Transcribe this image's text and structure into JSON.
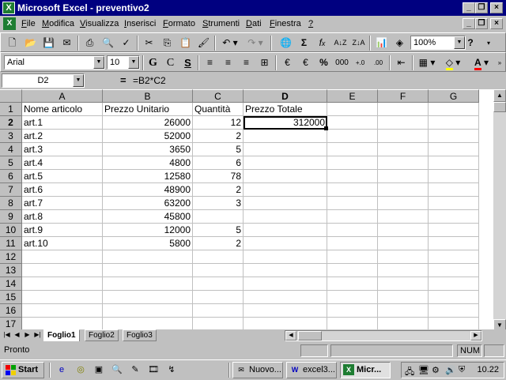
{
  "window": {
    "title": "Microsoft Excel - preventivo2",
    "app_icon": "excel-icon"
  },
  "menu": {
    "items": [
      {
        "label": "File",
        "accel": "F",
        "rest": "ile"
      },
      {
        "label": "Modifica",
        "accel": "M",
        "rest": "odifica"
      },
      {
        "label": "Visualizza",
        "accel": "V",
        "rest": "isualizza"
      },
      {
        "label": "Inserisci",
        "accel": "I",
        "rest": "nserisci"
      },
      {
        "label": "Formato",
        "accel": "F",
        "rest": "ormato"
      },
      {
        "label": "Strumenti",
        "accel": "S",
        "rest": "trumenti"
      },
      {
        "label": "Dati",
        "accel": "D",
        "rest": "ati"
      },
      {
        "label": "Finestra",
        "accel": "F",
        "rest": "inestra"
      },
      {
        "label": "?",
        "accel": "?",
        "rest": ""
      }
    ]
  },
  "standard_toolbar": {
    "zoom": "100%"
  },
  "format_toolbar": {
    "font": "Arial",
    "size": "10",
    "bold": "G",
    "italic": "C",
    "underline": "S",
    "currency": "€",
    "percent": "%",
    "thousands": "000"
  },
  "formula_bar": {
    "name_box": "D2",
    "equals": "=",
    "formula": "=B2*C2"
  },
  "sheet": {
    "columns": [
      "A",
      "B",
      "C",
      "D",
      "E",
      "F",
      "G"
    ],
    "selected_column": "D",
    "selected_row": "2",
    "rows": [
      "1",
      "2",
      "3",
      "4",
      "5",
      "6",
      "7",
      "8",
      "9",
      "10",
      "11",
      "12",
      "13",
      "14",
      "15",
      "16",
      "17"
    ],
    "header_row": [
      "Nome articolo",
      "Prezzo Unitario",
      "Quantità",
      "Prezzo Totale"
    ],
    "data": [
      [
        "art.1",
        "26000",
        "12",
        "312000"
      ],
      [
        "art.2",
        "52000",
        "2",
        ""
      ],
      [
        "art.3",
        "3650",
        "5",
        ""
      ],
      [
        "art.4",
        "4800",
        "6",
        ""
      ],
      [
        "art.5",
        "12580",
        "78",
        ""
      ],
      [
        "art.6",
        "48900",
        "2",
        ""
      ],
      [
        "art.7",
        "63200",
        "3",
        ""
      ],
      [
        "art.8",
        "45800",
        "",
        ""
      ],
      [
        "art.9",
        "12000",
        "5",
        ""
      ],
      [
        "art.10",
        "5800",
        "2",
        ""
      ]
    ]
  },
  "tabs": [
    "Foglio1",
    "Foglio2",
    "Foglio3"
  ],
  "active_tab": "Foglio1",
  "status": {
    "text": "Pronto",
    "num": "NUM"
  },
  "taskbar": {
    "start": "Start",
    "buttons": [
      {
        "label": "Nuovo...",
        "icon": "outlook-icon"
      },
      {
        "label": "excel3...",
        "icon": "word-icon"
      },
      {
        "label": "Micr...",
        "icon": "excel-icon"
      }
    ],
    "active_button": "Micr...",
    "clock": "10.22"
  }
}
